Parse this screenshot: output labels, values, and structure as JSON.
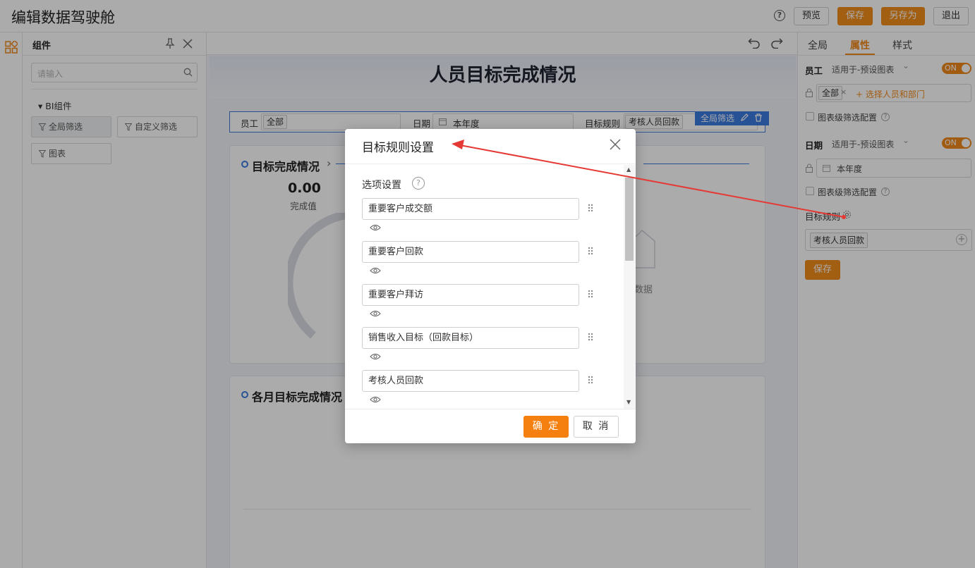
{
  "header": {
    "title": "编辑数据驾驶舱",
    "help": "?",
    "preview": "预览",
    "save": "保存",
    "save_as": "另存为",
    "exit": "退出"
  },
  "left_panel": {
    "title": "组件",
    "search_placeholder": "请输入",
    "group": "▾ BI组件",
    "items": [
      "全局筛选",
      "自定义筛选",
      "图表"
    ]
  },
  "dashboard": {
    "title": "人员目标完成情况",
    "filters": {
      "employee_label": "员工",
      "employee_value": "全部",
      "date_label": "日期",
      "date_value": "本年度",
      "rule_label": "目标规则",
      "rule_value": "考核人员回款",
      "badge": "全局筛选"
    },
    "section1": {
      "title": "目标完成情况",
      "value": "0.00",
      "value_label": "完成值",
      "no_data": "数据"
    },
    "section2": {
      "title": "各月目标完成情况"
    }
  },
  "right_panel": {
    "tabs": [
      "全局",
      "属性",
      "样式"
    ],
    "active_tab": "属性",
    "employee": {
      "label": "员工",
      "apply": "适用于-预设图表",
      "toggle": "ON",
      "tag": "全部",
      "add": "+ 选择人员和部门",
      "chart_filter": "图表级筛选配置"
    },
    "date": {
      "label": "日期",
      "apply": "适用于-预设图表",
      "toggle": "ON",
      "value": "本年度",
      "chart_filter": "图表级筛选配置"
    },
    "rule": {
      "label": "目标规则",
      "tag": "考核人员回款"
    },
    "save": "保存"
  },
  "modal": {
    "title": "目标规则设置",
    "section_label": "选项设置",
    "help": "?",
    "options": [
      "重要客户成交额",
      "重要客户回款",
      "重要客户拜访",
      "销售收入目标（回款目标）",
      "考核人员回款"
    ],
    "confirm": "确 定",
    "cancel": "取 消"
  },
  "colors": {
    "accent": "#f28c1a",
    "blue": "#3d7be0",
    "annotation_arrow": "#e53935"
  }
}
